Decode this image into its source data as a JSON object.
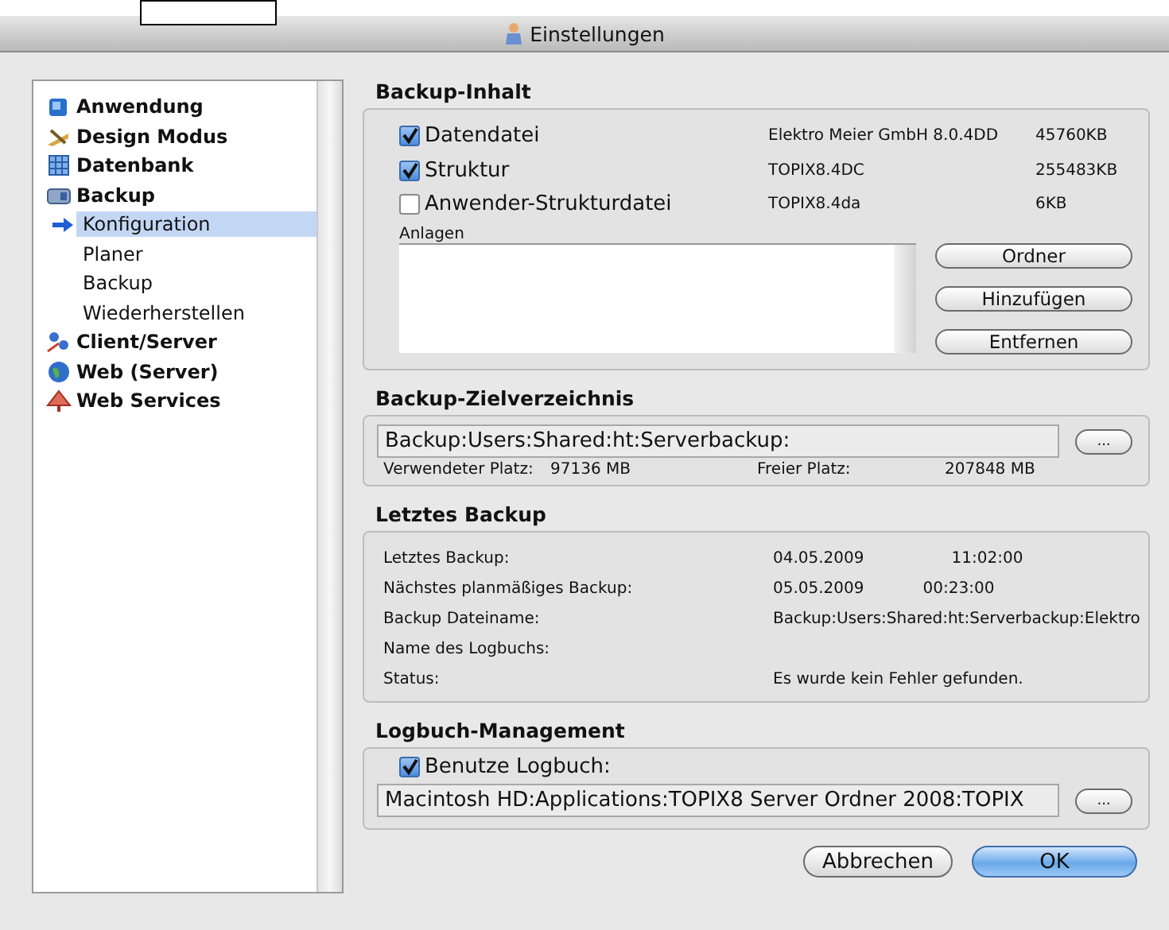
{
  "window": {
    "title": "Einstellungen"
  },
  "sidebar": {
    "items": [
      {
        "label": "Anwendung",
        "selected": false
      },
      {
        "label": "Design Modus",
        "selected": false
      },
      {
        "label": "Datenbank",
        "selected": false
      },
      {
        "label": "Backup",
        "selected": false,
        "children": [
          {
            "label": "Konfiguration",
            "selected": true
          },
          {
            "label": "Planer",
            "selected": false
          },
          {
            "label": "Backup",
            "selected": false
          },
          {
            "label": "Wiederherstellen",
            "selected": false
          }
        ]
      },
      {
        "label": "Client/Server",
        "selected": false
      },
      {
        "label": "Web (Server)",
        "selected": false
      },
      {
        "label": "Web Services",
        "selected": false
      }
    ]
  },
  "backup_content": {
    "title": "Backup-Inhalt",
    "items": [
      {
        "label": "Datendatei",
        "checked": true,
        "file": "Elektro Meier GmbH 8.0.4DD",
        "size": "45760KB"
      },
      {
        "label": "Struktur",
        "checked": true,
        "file": "TOPIX8.4DC",
        "size": "255483KB"
      },
      {
        "label": "Anwender-Strukturdatei",
        "checked": false,
        "file": "TOPIX8.4da",
        "size": "6KB"
      }
    ],
    "attachments_label": "Anlagen",
    "buttons": [
      "Ordner",
      "Hinzufügen",
      "Entfernen"
    ]
  },
  "target": {
    "title": "Backup-Zielverzeichnis",
    "path": "Backup:Users:Shared:ht:Serverbackup:",
    "browse_button": "...",
    "used_label": "Verwendeter Platz:",
    "used": "97136 MB",
    "free_label": "Freier Platz:",
    "free": "207848 MB"
  },
  "last_backup": {
    "title": "Letztes Backup",
    "rows": [
      {
        "label": "Letztes Backup:",
        "values": [
          "04.05.2009",
          "11:02:00"
        ]
      },
      {
        "label": "Nächstes planmäßiges Backup:",
        "values": [
          "05.05.2009",
          "00:23:00"
        ]
      },
      {
        "label": "Backup Dateiname:",
        "values": [
          "Backup:Users:Shared:ht:Serverbackup:Elektro"
        ]
      },
      {
        "label": "Name des Logbuchs:",
        "values": []
      },
      {
        "label": "Status:",
        "values": [
          "Es wurde kein Fehler gefunden."
        ]
      }
    ]
  },
  "log": {
    "title": "Logbuch-Management",
    "checkbox": {
      "label": "Benutze Logbuch:",
      "checked": true
    },
    "path": "Macintosh HD:Applications:TOPIX8 Server Ordner 2008:TOPIX",
    "browse_button": "..."
  },
  "buttons": [
    {
      "label": "Abbrechen",
      "default": false
    },
    {
      "label": "OK",
      "default": true
    }
  ]
}
